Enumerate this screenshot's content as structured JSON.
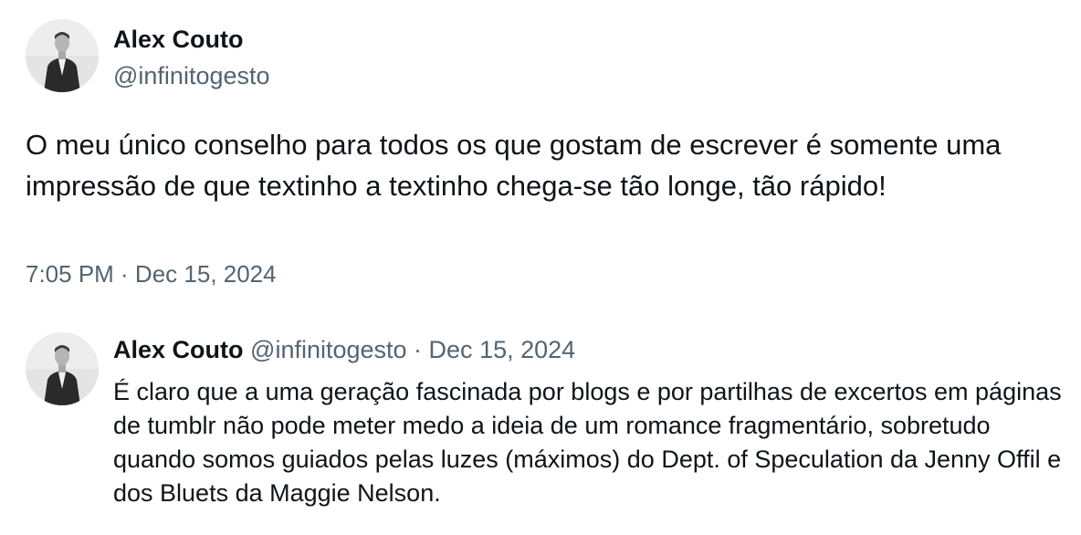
{
  "tweet": {
    "author": {
      "display_name": "Alex Couto",
      "handle": "@infinitogesto",
      "avatar": "avatar-photo"
    },
    "text": "O meu único conselho para todos os que gostam de escrever é somente uma impressão de que textinho a textinho chega-se tão longe, tão rápido!",
    "timestamp": "7:05 PM · Dec 15, 2024"
  },
  "reply": {
    "author": {
      "display_name": "Alex Couto",
      "handle": "@infinitogesto",
      "avatar": "avatar-photo"
    },
    "separator": " · ",
    "date": "Dec 15, 2024",
    "text": "É claro que a uma geração fascinada por blogs e por partilhas de excertos em páginas de tumblr não pode meter medo a ideia de um romance fragmentário, sobretudo quando somos guiados pelas luzes (máximos) do Dept. of Speculation da Jenny Offil e dos Bluets da Maggie Nelson."
  },
  "colors": {
    "text_primary": "#0f1419",
    "text_secondary": "#536471",
    "background": "#ffffff"
  }
}
